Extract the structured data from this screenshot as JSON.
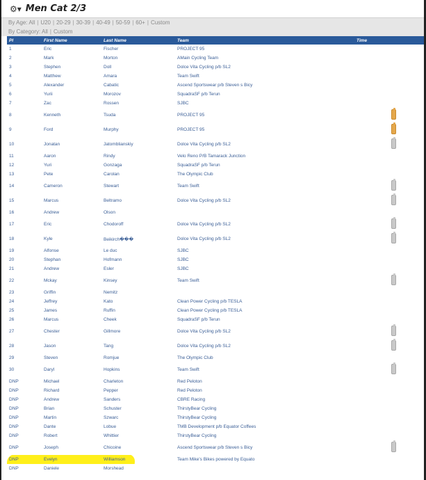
{
  "header": {
    "title": "Men Cat 2/3",
    "icon": "gear-icon"
  },
  "filters": {
    "age_label": "By Age:",
    "age_options": [
      "All",
      "U20",
      "20-29",
      "30-39",
      "40-49",
      "50-59",
      "60+",
      "Custom"
    ],
    "category_label": "By Category:",
    "category_options": [
      "All",
      "Custom"
    ]
  },
  "columns": [
    "Pl",
    "First Name",
    "Last Name",
    "Team",
    "Time"
  ],
  "rows": [
    {
      "pl": "1",
      "first": "Eric",
      "last": "Fischer",
      "team": "PROJECT 95",
      "bottle": ""
    },
    {
      "pl": "2",
      "first": "Mark",
      "last": "Morton",
      "team": "AMain Cycling Team",
      "bottle": ""
    },
    {
      "pl": "3",
      "first": "Stephen",
      "last": "Doll",
      "team": "Dolce Vita Cycling p/b SL2",
      "bottle": ""
    },
    {
      "pl": "4",
      "first": "Matthew",
      "last": "Amara",
      "team": "Team Swift",
      "bottle": ""
    },
    {
      "pl": "5",
      "first": "Alexander",
      "last": "Cabatic",
      "team": "Ascend Sportswear p/b Steven s Bicy",
      "bottle": ""
    },
    {
      "pl": "6",
      "first": "Yurii",
      "last": "Morozov",
      "team": "SquadraSF p/b Terun",
      "bottle": ""
    },
    {
      "pl": "7",
      "first": "Zac",
      "last": "Rossen",
      "team": "SJBC",
      "bottle": ""
    },
    {
      "pl": "8",
      "first": "Kenneth",
      "last": "Tsuda",
      "team": "PROJECT 95",
      "bottle": "orange"
    },
    {
      "pl": "9",
      "first": "Ford",
      "last": "Murphy",
      "team": "PROJECT 95",
      "bottle": "orange"
    },
    {
      "pl": "10",
      "first": "Jonatan",
      "last": "Jatomblianskiy",
      "team": "Dolce Vita Cycling p/b SL2",
      "bottle": "gray"
    },
    {
      "pl": "11",
      "first": "Aaron",
      "last": "Rindy",
      "team": "Velo Reno P/B Tamarack Junction",
      "bottle": ""
    },
    {
      "pl": "12",
      "first": "Yuri",
      "last": "Gonzaga",
      "team": "SquadraSF p/b Terun",
      "bottle": ""
    },
    {
      "pl": "13",
      "first": "Pete",
      "last": "Carolan",
      "team": "The Olympic Club",
      "bottle": ""
    },
    {
      "pl": "14",
      "first": "Cameron",
      "last": "Stewart",
      "team": "Team Swift",
      "bottle": "gray"
    },
    {
      "pl": "15",
      "first": "Marcus",
      "last": "Beltramo",
      "team": "Dolce Vita Cycling p/b SL2",
      "bottle": "gray"
    },
    {
      "pl": "16",
      "first": "Andrew",
      "last": "Olson",
      "team": "",
      "bottle": ""
    },
    {
      "pl": "17",
      "first": "Eric",
      "last": "Chodoroff",
      "team": "Dolce Vita Cycling p/b SL2",
      "bottle": "gray"
    },
    {
      "pl": "18",
      "first": "Kyle",
      "last": "Beikirch���",
      "team": "Dolce Vita Cycling p/b SL2",
      "bottle": "gray"
    },
    {
      "pl": "19",
      "first": "Alfonse",
      "last": "Le duc",
      "team": "SJBC",
      "bottle": ""
    },
    {
      "pl": "20",
      "first": "Stephan",
      "last": "Hofmann",
      "team": "SJBC",
      "bottle": ""
    },
    {
      "pl": "21",
      "first": "Andrew",
      "last": "Esler",
      "team": "SJBC",
      "bottle": ""
    },
    {
      "pl": "22",
      "first": "Mckay",
      "last": "Kinsey",
      "team": "Team Swift",
      "bottle": "gray"
    },
    {
      "pl": "23",
      "first": "Griffin",
      "last": "Nemitz",
      "team": "",
      "bottle": ""
    },
    {
      "pl": "24",
      "first": "Jeffrey",
      "last": "Kato",
      "team": "Clean Power Cycling p/b TESLA",
      "bottle": ""
    },
    {
      "pl": "25",
      "first": "James",
      "last": "Ruffin",
      "team": "Clean Power Cycling p/b TESLA",
      "bottle": ""
    },
    {
      "pl": "26",
      "first": "Marcus",
      "last": "Cheek",
      "team": "SquadraSF p/b Terun",
      "bottle": ""
    },
    {
      "pl": "27",
      "first": "Chester",
      "last": "Gillmore",
      "team": "Dolce Vita Cycling p/b SL2",
      "bottle": "gray"
    },
    {
      "pl": "28",
      "first": "Jason",
      "last": "Tang",
      "team": "Dolce Vita Cycling p/b SL2",
      "bottle": "gray"
    },
    {
      "pl": "29",
      "first": "Steven",
      "last": "Romjue",
      "team": "The Olympic Club",
      "bottle": ""
    },
    {
      "pl": "30",
      "first": "Daryl",
      "last": "Hopkins",
      "team": "Team Swift",
      "bottle": "gray"
    },
    {
      "pl": "DNP",
      "first": "Michael",
      "last": "Charleton",
      "team": "Red Peloton",
      "bottle": ""
    },
    {
      "pl": "DNP",
      "first": "Richard",
      "last": "Pepper",
      "team": "Red Peloton",
      "bottle": ""
    },
    {
      "pl": "DNP",
      "first": "Andrew",
      "last": "Sanders",
      "team": "CBRE Racing",
      "bottle": ""
    },
    {
      "pl": "DNP",
      "first": "Brian",
      "last": "Schuster",
      "team": "ThirstyBear Cycling",
      "bottle": ""
    },
    {
      "pl": "DNP",
      "first": "Martin",
      "last": "Szwarc",
      "team": "ThirstyBear Cycling",
      "bottle": ""
    },
    {
      "pl": "DNP",
      "first": "Dante",
      "last": "Lobue",
      "team": "TMB Development p/b Equator Coffees",
      "bottle": ""
    },
    {
      "pl": "DNP",
      "first": "Robert",
      "last": "Whittier",
      "team": "ThirstyBear Cycling",
      "bottle": ""
    },
    {
      "pl": "DNP",
      "first": "Joseph",
      "last": "Chicoine",
      "team": "Ascend Sportswear p/b Steven s Bicy",
      "bottle": "gray"
    },
    {
      "pl": "DNP",
      "first": "Evelyn",
      "last": "Williamson",
      "team": "Team Mike's Bikes powered by Equato",
      "bottle": ""
    },
    {
      "pl": "DNP",
      "first": "Daniele",
      "last": "Morshead",
      "team": "",
      "bottle": ""
    }
  ],
  "highlight_color": "#ffef1a",
  "header_row_color": "#2a5a9a"
}
